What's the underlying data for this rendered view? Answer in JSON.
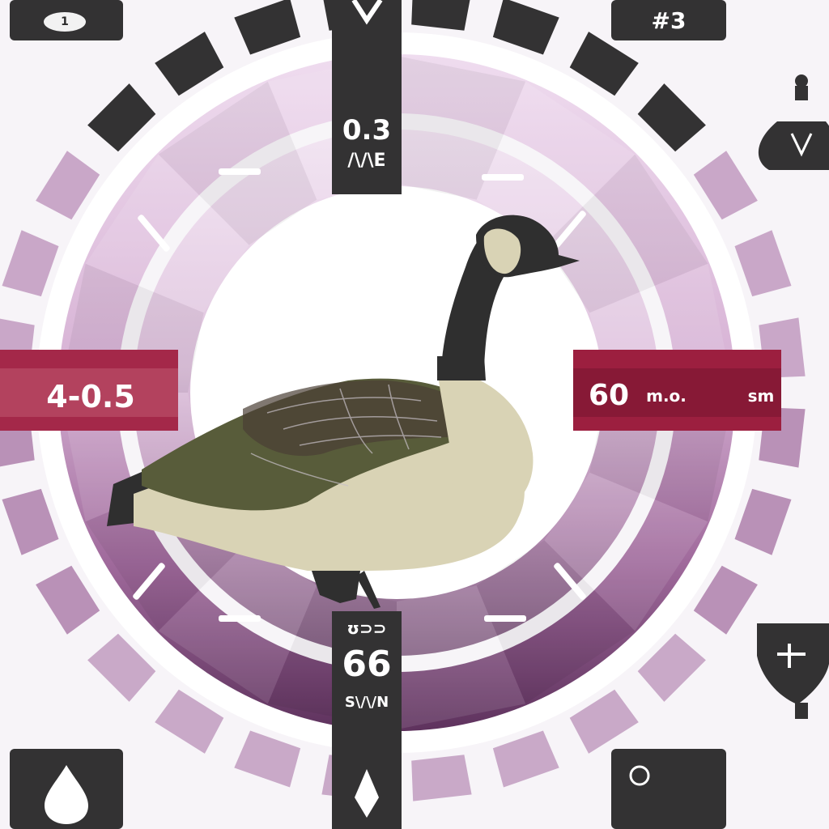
{
  "dial": {
    "top_readout": "0.3",
    "top_subreadout": "/\\/\\E",
    "left_readout": "4-0.5",
    "right_readout": "60",
    "right_unit_a": "m.o.",
    "right_unit_b": "sm",
    "bottom_readout": "66",
    "bottom_subreadout": "S\\/\\/N",
    "top_bar_counter": "ʊ⊃⊃",
    "corner_top_right_label": "#3",
    "colors": {
      "ring_light": "#e6cde6",
      "ring_mid": "#c8a2c8",
      "ring_dark": "#7d4d79",
      "ring_darkest": "#5b2f5a",
      "accent_red": "#9c1f3f",
      "panel_dark": "#333233",
      "goose_black": "#2f2f2f",
      "goose_olive": "#585c3a",
      "goose_cream": "#d9d3b5"
    }
  },
  "icons": {
    "top_left": "hat-icon",
    "top_center": "chevron-down-icon",
    "top_right": "counter-icon",
    "right_upper": "weight-icon",
    "right_lower": "shield-plus-icon",
    "bottom_left": "drop-icon",
    "bottom_center": "spade-icon",
    "bottom_right": "circle-icon"
  }
}
